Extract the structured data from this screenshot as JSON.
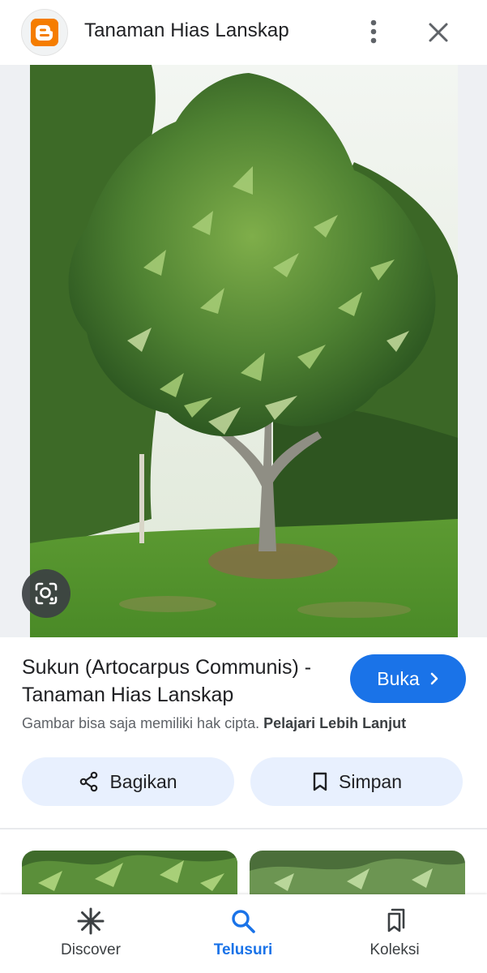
{
  "header": {
    "title": "Tanaman Hias Lanskap",
    "site_icon": "blogger-icon",
    "more_icon": "more-vert-icon",
    "close_icon": "close-icon"
  },
  "image": {
    "lens_icon": "google-lens-icon"
  },
  "result": {
    "title": "Sukun (Artocarpus Communis) - Tanaman Hias Lanskap",
    "open_label": "Buka",
    "copyright_text": "Gambar bisa saja memiliki hak cipta.",
    "learn_more": "Pelajari Lebih Lanjut"
  },
  "actions": {
    "share_label": "Bagikan",
    "save_label": "Simpan"
  },
  "bottom_nav": {
    "items": [
      {
        "label": "Discover",
        "icon": "asterisk-icon"
      },
      {
        "label": "Telusuri",
        "icon": "search-icon",
        "active": true
      },
      {
        "label": "Koleksi",
        "icon": "collections-icon"
      }
    ]
  },
  "colors": {
    "accent": "#1a73e8",
    "chip_bg": "#e8f0fe",
    "blogger_orange": "#f57d00"
  }
}
